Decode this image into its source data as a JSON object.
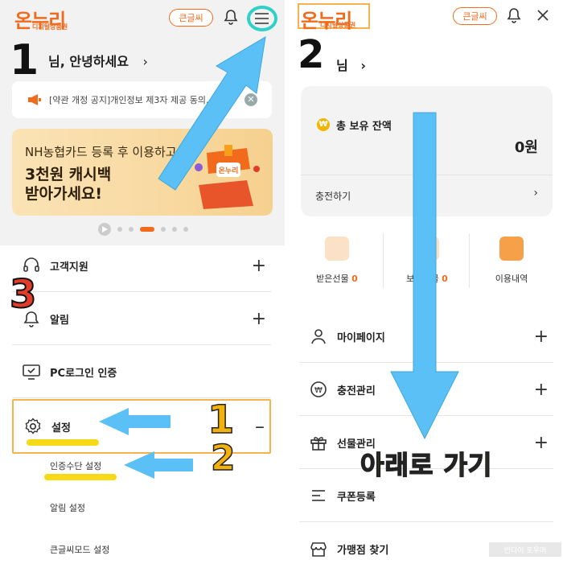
{
  "left": {
    "logo_main": "온누리",
    "logo_sub": "디지털상품권",
    "mode_button": "큰글씨",
    "greeting": "님, 안녕하세요",
    "notice": "[약관 개정 공지]개인정보 제3자 제공 동의...",
    "banner": {
      "line1": "NH농협카드 등록 후 이용하고",
      "line2": "3천원 캐시백",
      "line3": "받아가세요!"
    },
    "menu": {
      "support": "고객지원",
      "alarm": "알림",
      "pc_login": "PC로그인 인증",
      "settings": "설정",
      "sub_auth": "인증수단 설정",
      "sub_alarm": "알림 설정",
      "sub_bigtext": "큰글씨모드 설정"
    }
  },
  "right": {
    "logo_main": "온누리",
    "logo_sub": "디지털상품권",
    "mode_button": "큰글씨",
    "greeting": "님",
    "balance": {
      "title": "총 보유 잔액",
      "currency_badge": "₩",
      "amount": "0원",
      "charge": "충전하기"
    },
    "stats": [
      {
        "label": "받은선물",
        "count": "0"
      },
      {
        "label": "보낸선물",
        "count": "0"
      },
      {
        "label": "이용내역",
        "count": ""
      }
    ],
    "menu": {
      "mypage": "마이페이지",
      "charge_mgmt": "충전관리",
      "gift_mgmt": "선물관리",
      "coupon": "쿠폰등록",
      "store": "가맹점 찾기"
    },
    "watermark": "반다이 포우머"
  },
  "annotations": {
    "n1_left": "1",
    "n2_right": "2",
    "n3": "3",
    "n1_settings": "1",
    "n2_auth": "2",
    "down_text": "아래로 가기"
  },
  "colors": {
    "accent": "#f26b1d",
    "arrow": "#5bc0f5",
    "highlight": "#f5d80b",
    "teal_circle": "#2fd1c8"
  }
}
